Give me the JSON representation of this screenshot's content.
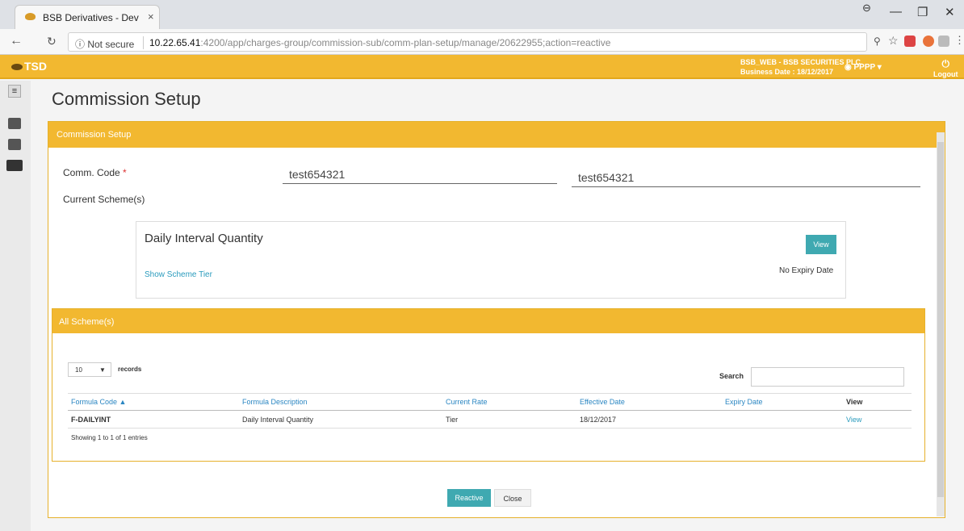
{
  "browser": {
    "tab_title": "BSB Derivatives - Dev",
    "tab_close": "×",
    "not_secure": "ⓘ Not secure",
    "url_host": "10.22.65.41",
    "url_path": ":4200/app/charges-group/commission-sub/comm-plan-setup/manage/20622955;action=reactive",
    "minimize": "—",
    "maximize": "❐",
    "close": "✕"
  },
  "header": {
    "logo": "TSD",
    "company": "BSB_WEB - BSB SECURITIES PLC.",
    "business_date": "Business Date : 18/12/2017",
    "user": "PPPP ▾",
    "logout": "Logout"
  },
  "page": {
    "title": "Commission Setup",
    "panel_title": "Commission Setup",
    "comm_code_label": "Comm. Code",
    "required_mark": "*",
    "comm_code_value": "test654321",
    "comm_code_value_2": "test654321",
    "current_schemes_label": "Current Scheme(s)"
  },
  "current_scheme": {
    "name": "Daily Interval Quantity",
    "view_button": "View",
    "show_tier": "Show Scheme Tier",
    "expiry": "No Expiry Date"
  },
  "all_schemes": {
    "title": "All Scheme(s)",
    "page_size": "10",
    "records_label": "records",
    "search_label": "Search",
    "columns": [
      "Formula Code ▲",
      "Formula Description",
      "Current Rate",
      "Effective Date",
      "Expiry Date",
      "View"
    ],
    "rows": [
      {
        "code": "F-DAILYINT",
        "description": "Daily Interval Quantity",
        "rate": "Tier",
        "effective": "18/12/2017",
        "expiry": "",
        "view": "View"
      }
    ],
    "showing": "Showing 1 to 1 of 1 entries"
  },
  "actions": {
    "reactive": "Reactive",
    "close": "Close"
  },
  "colors": {
    "accent": "#f2b830",
    "teal": "#3fa9b1",
    "link": "#2a9bbd"
  }
}
